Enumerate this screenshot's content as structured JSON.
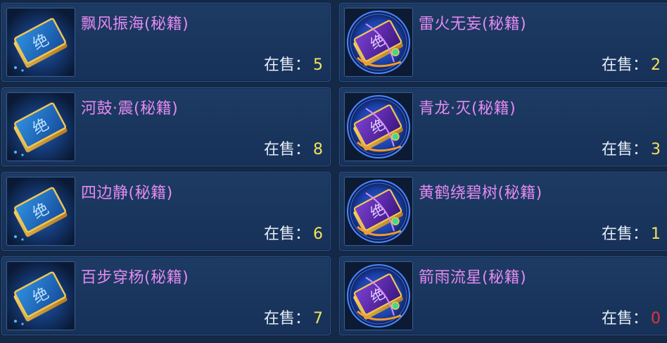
{
  "items": [
    {
      "name": "飘风振海(秘籍)",
      "sale_label": "在售：",
      "count": "5",
      "icon": "blue-book-icon"
    },
    {
      "name": "雷火无妄(秘籍)",
      "sale_label": "在售：",
      "count": "2",
      "icon": "purple-orb-book-icon"
    },
    {
      "name": "河鼓·震(秘籍)",
      "sale_label": "在售：",
      "count": "8",
      "icon": "blue-book-icon"
    },
    {
      "name": "青龙·灭(秘籍)",
      "sale_label": "在售：",
      "count": "3",
      "icon": "purple-orb-book-icon"
    },
    {
      "name": "四边静(秘籍)",
      "sale_label": "在售：",
      "count": "6",
      "icon": "blue-book-icon"
    },
    {
      "name": "黄鹤绕碧树(秘籍)",
      "sale_label": "在售：",
      "count": "1",
      "icon": "purple-orb-book-icon"
    },
    {
      "name": "百步穿杨(秘籍)",
      "sale_label": "在售：",
      "count": "7",
      "icon": "blue-book-icon"
    },
    {
      "name": "箭雨流星(秘籍)",
      "sale_label": "在售：",
      "count": "0",
      "icon": "purple-orb-book-icon"
    }
  ],
  "colors": {
    "name": "#e38af0",
    "count": "#f2e25c",
    "count_zero": "#e43434",
    "label": "#e6ecf5"
  }
}
